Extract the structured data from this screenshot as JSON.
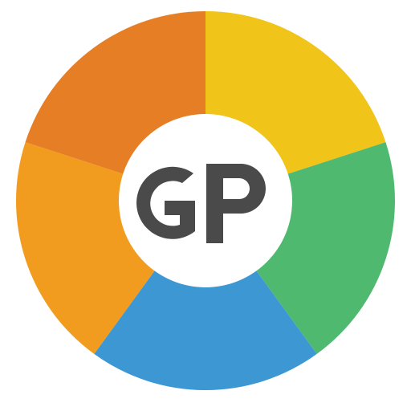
{
  "logo": {
    "lettering": "GP",
    "colors": {
      "segment_orange_dark": "#E57E25",
      "segment_yellow": "#F0C419",
      "segment_green": "#4FBA6F",
      "segment_blue": "#3D97D3",
      "segment_orange_light": "#F29C1F",
      "center": "#FFFFFF",
      "lettering": "#4A4A4A"
    },
    "segments": [
      {
        "name": "segment-yellow",
        "color_key": "segment_yellow"
      },
      {
        "name": "segment-green",
        "color_key": "segment_green"
      },
      {
        "name": "segment-blue",
        "color_key": "segment_blue"
      },
      {
        "name": "segment-orange-light",
        "color_key": "segment_orange_light"
      },
      {
        "name": "segment-orange-dark",
        "color_key": "segment_orange_dark"
      }
    ]
  }
}
